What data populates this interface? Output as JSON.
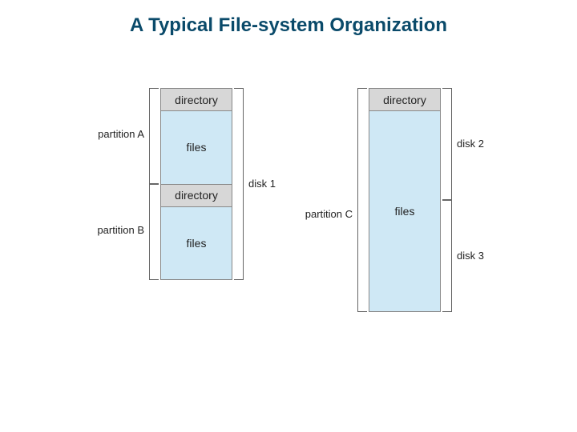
{
  "title": "A Typical File-system Organization",
  "left_stack": {
    "dir1": "directory",
    "file1": "files",
    "dir2": "directory",
    "file2": "files"
  },
  "right_stack": {
    "dir": "directory",
    "file": "files"
  },
  "labels": {
    "partitionA": "partition A",
    "partitionB": "partition B",
    "partitionC": "partition C",
    "disk1": "disk 1",
    "disk2": "disk 2",
    "disk3": "disk 3"
  }
}
